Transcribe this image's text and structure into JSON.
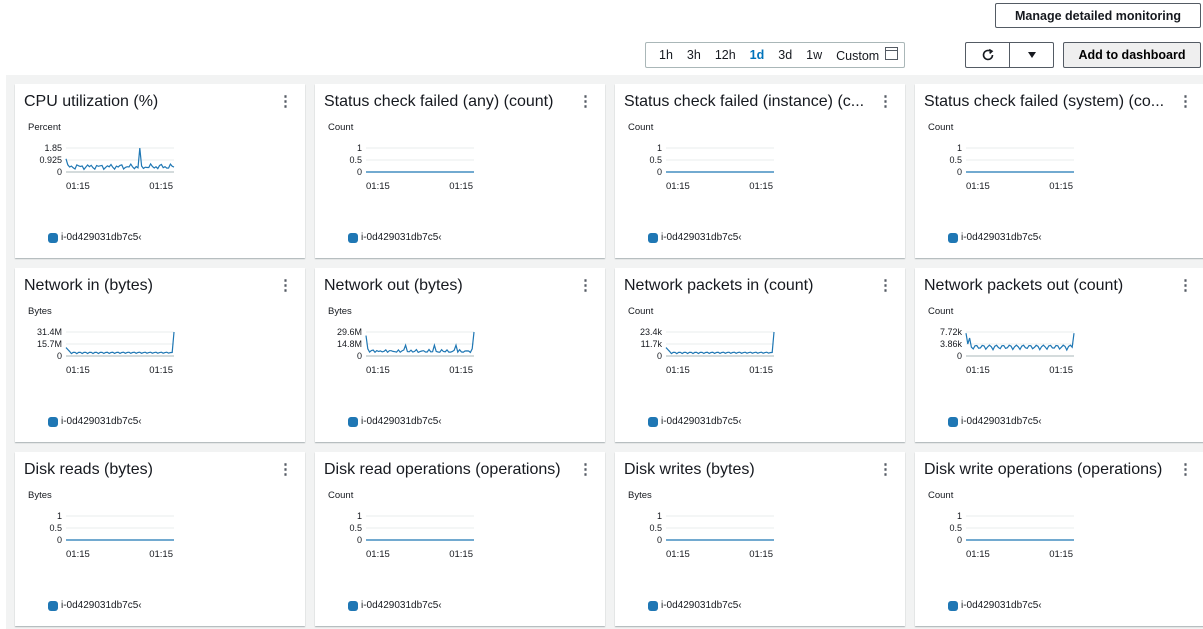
{
  "toolbar": {
    "manage_label": "Manage detailed monitoring",
    "ranges": [
      "1h",
      "3h",
      "12h",
      "1d",
      "3d",
      "1w",
      "Custom"
    ],
    "active_range": "1d",
    "refresh_icon": "refresh-icon",
    "dropdown_icon": "caret-down-icon",
    "add_label": "Add to dashboard"
  },
  "colors": {
    "series": "#1f77b4",
    "active": "#0073bb",
    "panel_bg": "#f2f3f3"
  },
  "widgets": [
    {
      "title": "CPU utilization (%)",
      "unit": "Percent",
      "ticks": [
        "1.85",
        "0.925",
        "0"
      ],
      "x": [
        "01:15",
        "01:15"
      ],
      "legend": "i-0d429031db7c5‹",
      "shape": "cpu"
    },
    {
      "title": "Status check failed (any) (count)",
      "unit": "Count",
      "ticks": [
        "1",
        "0.5",
        "0"
      ],
      "x": [
        "01:15",
        "01:15"
      ],
      "legend": "i-0d429031db7c5‹",
      "shape": "flat"
    },
    {
      "title": "Status check failed (instance) (c...",
      "unit": "Count",
      "ticks": [
        "1",
        "0.5",
        "0"
      ],
      "x": [
        "01:15",
        "01:15"
      ],
      "legend": "i-0d429031db7c5‹",
      "shape": "flat"
    },
    {
      "title": "Status check failed (system) (co...",
      "unit": "Count",
      "ticks": [
        "1",
        "0.5",
        "0"
      ],
      "x": [
        "01:15",
        "01:15"
      ],
      "legend": "i-0d429031db7c5‹",
      "shape": "flat"
    },
    {
      "title": "Network in (bytes)",
      "unit": "Bytes",
      "ticks": [
        "31.4M",
        "15.7M",
        "0"
      ],
      "x": [
        "01:15",
        "01:15"
      ],
      "legend": "i-0d429031db7c5‹",
      "shape": "netin"
    },
    {
      "title": "Network out (bytes)",
      "unit": "Bytes",
      "ticks": [
        "29.6M",
        "14.8M",
        "0"
      ],
      "x": [
        "01:15",
        "01:15"
      ],
      "legend": "i-0d429031db7c5‹",
      "shape": "netout"
    },
    {
      "title": "Network packets in (count)",
      "unit": "Count",
      "ticks": [
        "23.4k",
        "11.7k",
        "0"
      ],
      "x": [
        "01:15",
        "01:15"
      ],
      "legend": "i-0d429031db7c5‹",
      "shape": "netin"
    },
    {
      "title": "Network packets out (count)",
      "unit": "Count",
      "ticks": [
        "7.72k",
        "3.86k",
        "0"
      ],
      "x": [
        "01:15",
        "01:15"
      ],
      "legend": "i-0d429031db7c5‹",
      "shape": "pktout"
    },
    {
      "title": "Disk reads (bytes)",
      "unit": "Bytes",
      "ticks": [
        "1",
        "0.5",
        "0"
      ],
      "x": [
        "01:15",
        "01:15"
      ],
      "legend": "i-0d429031db7c5‹",
      "shape": "flat"
    },
    {
      "title": "Disk read operations (operations)",
      "unit": "Count",
      "ticks": [
        "1",
        "0.5",
        "0"
      ],
      "x": [
        "01:15",
        "01:15"
      ],
      "legend": "i-0d429031db7c5‹",
      "shape": "flat"
    },
    {
      "title": "Disk writes (bytes)",
      "unit": "Bytes",
      "ticks": [
        "1",
        "0.5",
        "0"
      ],
      "x": [
        "01:15",
        "01:15"
      ],
      "legend": "i-0d429031db7c5‹",
      "shape": "flat"
    },
    {
      "title": "Disk write operations (operations)",
      "unit": "Count",
      "ticks": [
        "1",
        "0.5",
        "0"
      ],
      "x": [
        "01:15",
        "01:15"
      ],
      "legend": "i-0d429031db7c5‹",
      "shape": "flat"
    }
  ]
}
